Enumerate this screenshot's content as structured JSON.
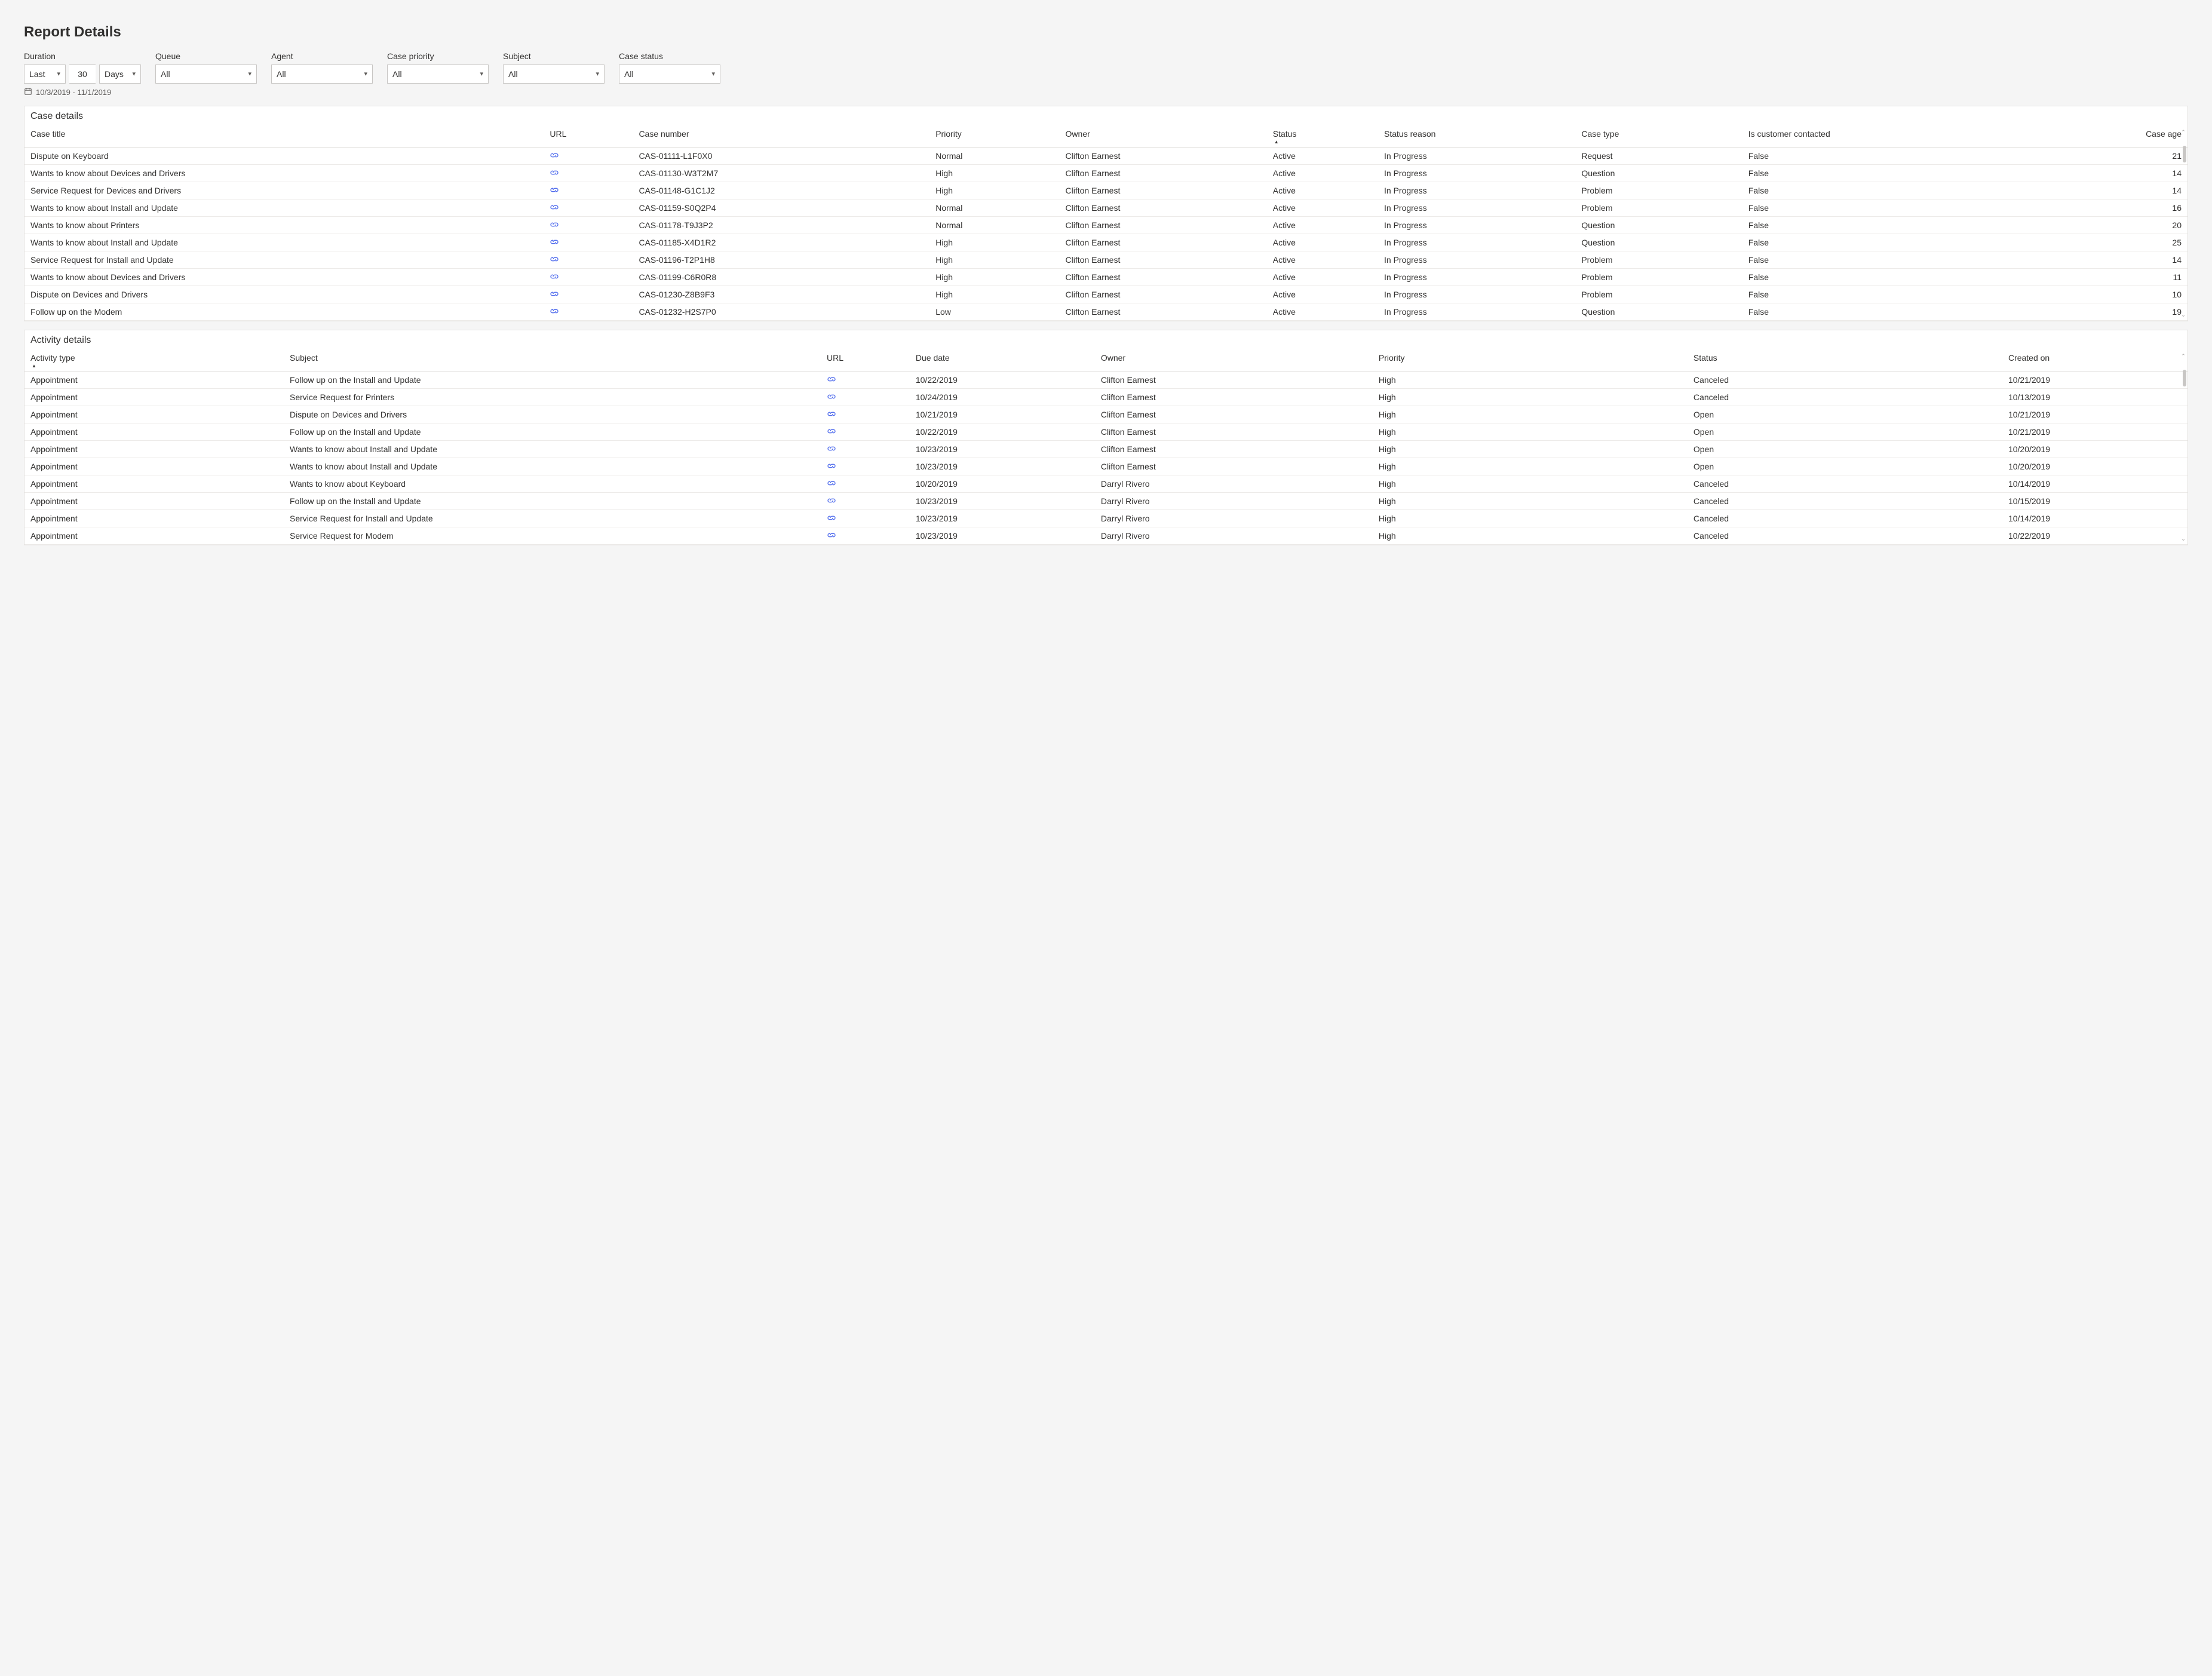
{
  "title": "Report Details",
  "filters": {
    "duration": {
      "label": "Duration",
      "mode": "Last",
      "value": "30",
      "unit": "Days"
    },
    "queue": {
      "label": "Queue",
      "value": "All"
    },
    "agent": {
      "label": "Agent",
      "value": "All"
    },
    "priority": {
      "label": "Case priority",
      "value": "All"
    },
    "subject": {
      "label": "Subject",
      "value": "All"
    },
    "status": {
      "label": "Case status",
      "value": "All"
    },
    "date_range": "10/3/2019 - 11/1/2019"
  },
  "case_details": {
    "title": "Case details",
    "headers": {
      "case_title": "Case title",
      "url": "URL",
      "case_number": "Case number",
      "priority": "Priority",
      "owner": "Owner",
      "status": "Status",
      "status_reason": "Status reason",
      "case_type": "Case type",
      "is_contacted": "Is customer contacted",
      "case_age": "Case age"
    },
    "rows": [
      {
        "title": "Dispute on Keyboard",
        "num": "CAS-01111-L1F0X0",
        "priority": "Normal",
        "owner": "Clifton Earnest",
        "status": "Active",
        "reason": "In Progress",
        "type": "Request",
        "contacted": "False",
        "age": "21"
      },
      {
        "title": "Wants to know about Devices and Drivers",
        "num": "CAS-01130-W3T2M7",
        "priority": "High",
        "owner": "Clifton Earnest",
        "status": "Active",
        "reason": "In Progress",
        "type": "Question",
        "contacted": "False",
        "age": "14"
      },
      {
        "title": "Service Request for Devices and Drivers",
        "num": "CAS-01148-G1C1J2",
        "priority": "High",
        "owner": "Clifton Earnest",
        "status": "Active",
        "reason": "In Progress",
        "type": "Problem",
        "contacted": "False",
        "age": "14"
      },
      {
        "title": "Wants to know about Install and Update",
        "num": "CAS-01159-S0Q2P4",
        "priority": "Normal",
        "owner": "Clifton Earnest",
        "status": "Active",
        "reason": "In Progress",
        "type": "Problem",
        "contacted": "False",
        "age": "16"
      },
      {
        "title": "Wants to know about Printers",
        "num": "CAS-01178-T9J3P2",
        "priority": "Normal",
        "owner": "Clifton Earnest",
        "status": "Active",
        "reason": "In Progress",
        "type": "Question",
        "contacted": "False",
        "age": "20"
      },
      {
        "title": "Wants to know about Install and Update",
        "num": "CAS-01185-X4D1R2",
        "priority": "High",
        "owner": "Clifton Earnest",
        "status": "Active",
        "reason": "In Progress",
        "type": "Question",
        "contacted": "False",
        "age": "25"
      },
      {
        "title": "Service Request for Install and Update",
        "num": "CAS-01196-T2P1H8",
        "priority": "High",
        "owner": "Clifton Earnest",
        "status": "Active",
        "reason": "In Progress",
        "type": "Problem",
        "contacted": "False",
        "age": "14"
      },
      {
        "title": "Wants to know about Devices and Drivers",
        "num": "CAS-01199-C6R0R8",
        "priority": "High",
        "owner": "Clifton Earnest",
        "status": "Active",
        "reason": "In Progress",
        "type": "Problem",
        "contacted": "False",
        "age": "11"
      },
      {
        "title": "Dispute on Devices and Drivers",
        "num": "CAS-01230-Z8B9F3",
        "priority": "High",
        "owner": "Clifton Earnest",
        "status": "Active",
        "reason": "In Progress",
        "type": "Problem",
        "contacted": "False",
        "age": "10"
      },
      {
        "title": "Follow up on the  Modem",
        "num": "CAS-01232-H2S7P0",
        "priority": "Low",
        "owner": "Clifton Earnest",
        "status": "Active",
        "reason": "In Progress",
        "type": "Question",
        "contacted": "False",
        "age": "19"
      }
    ]
  },
  "activity_details": {
    "title": "Activity details",
    "headers": {
      "activity_type": "Activity type",
      "subject": "Subject",
      "url": "URL",
      "due_date": "Due date",
      "owner": "Owner",
      "priority": "Priority",
      "status": "Status",
      "created_on": "Created on"
    },
    "rows": [
      {
        "type": "Appointment",
        "subject": "Follow up on the Install and Update",
        "due": "10/22/2019",
        "owner": "Clifton Earnest",
        "priority": "High",
        "status": "Canceled",
        "created": "10/21/2019"
      },
      {
        "type": "Appointment",
        "subject": "Service Request for Printers",
        "due": "10/24/2019",
        "owner": "Clifton Earnest",
        "priority": "High",
        "status": "Canceled",
        "created": "10/13/2019"
      },
      {
        "type": "Appointment",
        "subject": "Dispute on Devices and Drivers",
        "due": "10/21/2019",
        "owner": "Clifton Earnest",
        "priority": "High",
        "status": "Open",
        "created": "10/21/2019"
      },
      {
        "type": "Appointment",
        "subject": "Follow up on the Install and Update",
        "due": "10/22/2019",
        "owner": "Clifton Earnest",
        "priority": "High",
        "status": "Open",
        "created": "10/21/2019"
      },
      {
        "type": "Appointment",
        "subject": "Wants to know about Install and Update",
        "due": "10/23/2019",
        "owner": "Clifton Earnest",
        "priority": "High",
        "status": "Open",
        "created": "10/20/2019"
      },
      {
        "type": "Appointment",
        "subject": "Wants to know about Install and Update",
        "due": "10/23/2019",
        "owner": "Clifton Earnest",
        "priority": "High",
        "status": "Open",
        "created": "10/20/2019"
      },
      {
        "type": "Appointment",
        "subject": "Wants to know about Keyboard",
        "due": "10/20/2019",
        "owner": "Darryl Rivero",
        "priority": "High",
        "status": "Canceled",
        "created": "10/14/2019"
      },
      {
        "type": "Appointment",
        "subject": "Follow up on the Install and Update",
        "due": "10/23/2019",
        "owner": "Darryl Rivero",
        "priority": "High",
        "status": "Canceled",
        "created": "10/15/2019"
      },
      {
        "type": "Appointment",
        "subject": "Service Request for Install and Update",
        "due": "10/23/2019",
        "owner": "Darryl Rivero",
        "priority": "High",
        "status": "Canceled",
        "created": "10/14/2019"
      },
      {
        "type": "Appointment",
        "subject": "Service Request for Modem",
        "due": "10/23/2019",
        "owner": "Darryl Rivero",
        "priority": "High",
        "status": "Canceled",
        "created": "10/22/2019"
      }
    ]
  }
}
